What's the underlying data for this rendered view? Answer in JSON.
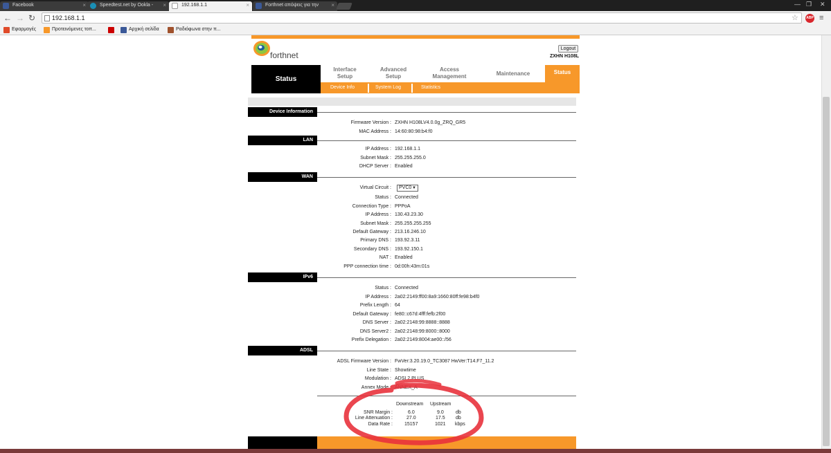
{
  "browser": {
    "tabs": [
      {
        "label": "Facebook",
        "color": "#3b5998",
        "active": false
      },
      {
        "label": "Speedtest.net by Ookla -",
        "color": "#1a8fb5",
        "active": false
      },
      {
        "label": "192.168.1.1",
        "color": "#888888",
        "active": true
      },
      {
        "label": "Forthnet απόψεις για την",
        "color": "#3b5998",
        "active": false
      }
    ],
    "address": "192.168.1.1",
    "bookmarks": [
      {
        "label": "Εφαρμογές",
        "color": "#e04b2a"
      },
      {
        "label": "Προτεινόμενες τοπ...",
        "color": "#f7982a"
      },
      {
        "label": "",
        "color": "#cc0000"
      },
      {
        "label": "Αρχική σελίδα",
        "color": "#3b5998"
      },
      {
        "label": "Ραδιόφωνα στην π...",
        "color": "#a0522d"
      }
    ]
  },
  "header": {
    "brand": "forthnet",
    "logout": "Logout",
    "model": "ZXHN H108L"
  },
  "nav": {
    "current": "Status",
    "items": [
      {
        "label": "Interface\nSetup"
      },
      {
        "label": "Advanced\nSetup"
      },
      {
        "label": "Access\nManagement"
      },
      {
        "label": "Maintenance"
      },
      {
        "label": "Status"
      }
    ],
    "sub": [
      "Device Info",
      "System Log",
      "Statistics"
    ]
  },
  "device": {
    "title": "Device Information",
    "rows": [
      {
        "label": "Firmware Version :",
        "value": "ZXHN H108LV4.0.0g_ZRQ_GR5"
      },
      {
        "label": "MAC Address :",
        "value": "14:60:80:98:b4:f0"
      }
    ]
  },
  "lan": {
    "title": "LAN",
    "rows": [
      {
        "label": "IP Address :",
        "value": "192.168.1.1"
      },
      {
        "label": "Subnet Mask :",
        "value": "255.255.255.0"
      },
      {
        "label": "DHCP Server :",
        "value": "Enabled"
      }
    ]
  },
  "wan": {
    "title": "WAN",
    "virtual_circuit_label": "Virtual Circuit :",
    "virtual_circuit_value": "PVC0",
    "rows": [
      {
        "label": "Status :",
        "value": "Connected"
      },
      {
        "label": "Connection Type :",
        "value": "PPPoA"
      },
      {
        "label": "IP Address :",
        "value": "130.43.23.30"
      },
      {
        "label": "Subnet Mask :",
        "value": "255.255.255.255"
      },
      {
        "label": "Default Gateway :",
        "value": "213.16.246.10"
      },
      {
        "label": "Primary DNS :",
        "value": "193.92.3.11"
      },
      {
        "label": "Secondary DNS :",
        "value": "193.92.150.1"
      },
      {
        "label": "NAT :",
        "value": "Enabled"
      },
      {
        "label": "PPP connection time :",
        "value": "0d:00h:43m:01s"
      }
    ]
  },
  "ipv6": {
    "title": "IPv6",
    "rows": [
      {
        "label": "Status :",
        "value": "Connected"
      },
      {
        "label": "IP Address :",
        "value": "2a02:2149:ff00:8a9:1660:80ff:fe98:b4f0"
      },
      {
        "label": "Prefix Length :",
        "value": "64"
      },
      {
        "label": "Default Gateway :",
        "value": "fe80::c67d:4fff:fefb:2f00"
      },
      {
        "label": "DNS Server :",
        "value": "2a02:2148:99:8888::8888"
      },
      {
        "label": "DNS Server2 :",
        "value": "2a02:2148:99:8000::8000"
      },
      {
        "label": "Prefix Delegation :",
        "value": "2a02:2149:8004:ae00::/56"
      }
    ]
  },
  "adsl": {
    "title": "ADSL",
    "rows": [
      {
        "label": "ADSL Firmware Version :",
        "value": "FwVer:3.20.19.0_TC3087 HwVer:T14.F7_11.2"
      },
      {
        "label": "Line State :",
        "value": "Showtime"
      },
      {
        "label": "Modulation :",
        "value": "ADSL2 PLUS"
      },
      {
        "label": "Annex Mode :",
        "value": "ANNEX_A"
      }
    ],
    "table": {
      "headers": [
        "Downstream",
        "Upstream"
      ],
      "rows": [
        {
          "label": "SNR Margin :",
          "down": "6.0",
          "up": "9.0",
          "unit": "db"
        },
        {
          "label": "Line Attenuation :",
          "down": "27.0",
          "up": "17.5",
          "unit": "db"
        },
        {
          "label": "Data Rate :",
          "down": "15157",
          "up": "1021",
          "unit": "kbps"
        }
      ]
    }
  },
  "colors": {
    "accent": "#f7982a",
    "annotation": "#e8323c"
  }
}
